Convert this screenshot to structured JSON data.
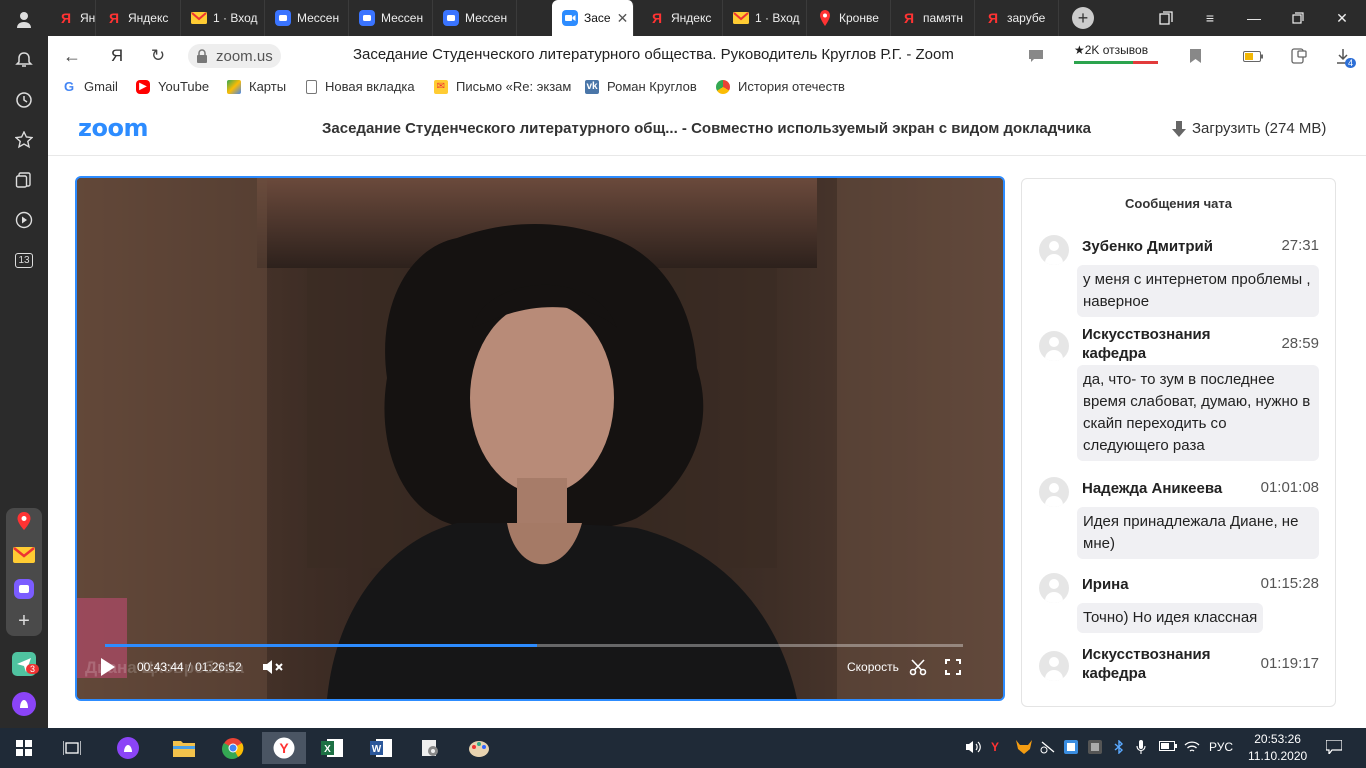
{
  "browser": {
    "tabs": [
      {
        "label": "Яндекс",
        "icon": "yandex-icon"
      },
      {
        "label": "Яндекс",
        "icon": "yandex-icon"
      },
      {
        "label": "1 · Вход",
        "icon": "mail-icon"
      },
      {
        "label": "Мессен",
        "icon": "messenger-icon"
      },
      {
        "label": "Мессен",
        "icon": "messenger-icon"
      },
      {
        "label": "Мессен",
        "icon": "messenger-icon"
      },
      {
        "label": "Засе",
        "icon": "zoom-icon",
        "active": true
      },
      {
        "label": "Яндекс",
        "icon": "yandex-icon"
      },
      {
        "label": "1 · Вход",
        "icon": "mail-icon"
      },
      {
        "label": "Кронве",
        "icon": "maps-pin-icon"
      },
      {
        "label": "памятн",
        "icon": "yandex-icon"
      },
      {
        "label": "зарубе",
        "icon": "yandex-icon"
      }
    ],
    "url": "zoom.us",
    "page_title": "Заседание Студенческого литературного общества. Руководитель Круглов Р.Г. - Zoom",
    "reviews": "★2K отзывов",
    "downloads_badge": "4",
    "bookmarks": [
      {
        "label": "Gmail",
        "icon": "gmail-icon"
      },
      {
        "label": "YouTube",
        "icon": "youtube-icon"
      },
      {
        "label": "Карты",
        "icon": "maps-icon"
      },
      {
        "label": "Новая вкладка",
        "icon": "page-icon"
      },
      {
        "label": "Письмо «Re: экзам",
        "icon": "mail-icon"
      },
      {
        "label": "Роман Круглов",
        "icon": "vk-icon"
      },
      {
        "label": "История отечеств",
        "icon": "chromium-icon"
      }
    ]
  },
  "sidebar": {
    "counter": "13",
    "messenger_badge": "3"
  },
  "zoom": {
    "logo": "zoom",
    "recording_title": "Заседание Студенческого литературного общ...",
    "recording_subtitle": "- Совместно используемый экран с видом докладчика",
    "download_label": "Загрузить (274 MB)"
  },
  "player": {
    "current_time": "00:43:44",
    "separator": "/",
    "duration": "01:26:52",
    "progress_fraction": 0.503,
    "speed_label": "Скорость",
    "speaker_name": "Диана Цховребова"
  },
  "chat": {
    "title": "Сообщения чата",
    "messages": [
      {
        "name": "Зубенко Дмитрий",
        "time": "27:31",
        "text": "у меня с интернетом проблемы , наверное"
      },
      {
        "name": "Искусствознания кафедра",
        "time": "28:59",
        "text": "да, что- то зум в последнее время слабоват, думаю, нужно в скайп переходить со следующего раза"
      },
      {
        "name": "Надежда Аникеева",
        "time": "01:01:08",
        "text": "Идея принадлежала Диане, не мне)"
      },
      {
        "name": "Ирина",
        "time": "01:15:28",
        "text": "Точно) Но идея классная"
      },
      {
        "name": "Искусствознания кафедра",
        "time": "01:19:17",
        "text": ""
      }
    ]
  },
  "taskbar": {
    "language": "РУС",
    "time": "20:53:26",
    "date": "11.10.2020"
  },
  "colors": {
    "zoom_blue": "#2d8cff",
    "dark_chrome": "#2b2b2b",
    "taskbar": "#1f2a37"
  }
}
